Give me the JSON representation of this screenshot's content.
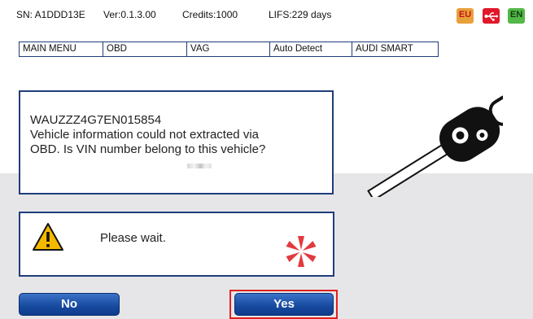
{
  "status_bar": {
    "serial": "SN: A1DDD13E",
    "version": "Ver:0.1.3.00",
    "credits": "Credits:1000",
    "lifs": "LIFS:229 days",
    "flag_eu": "EU",
    "flag_en": "EN"
  },
  "breadcrumb": [
    "MAIN MENU",
    "OBD",
    "VAG",
    "Auto Detect",
    "AUDI SMART"
  ],
  "message": {
    "vin": "WAUZZZ4G7EN015854",
    "line1": "Vehicle information could not extracted via",
    "line2": "OBD. Is VIN number belong to this vehicle?"
  },
  "wait": {
    "text": "Please wait."
  },
  "buttons": {
    "no": "No",
    "yes": "Yes"
  },
  "icons": {
    "warning": "warning-triangle-icon",
    "spinner": "loading-spinner-icon",
    "key": "car-key-icon",
    "usb": "usb-icon"
  },
  "colors": {
    "frame_blue": "#1f3d7a",
    "button_blue": "#16499e",
    "highlight_red": "#e02020",
    "spinner_red": "#e23a40",
    "panel_gray": "#e6e6e8"
  }
}
